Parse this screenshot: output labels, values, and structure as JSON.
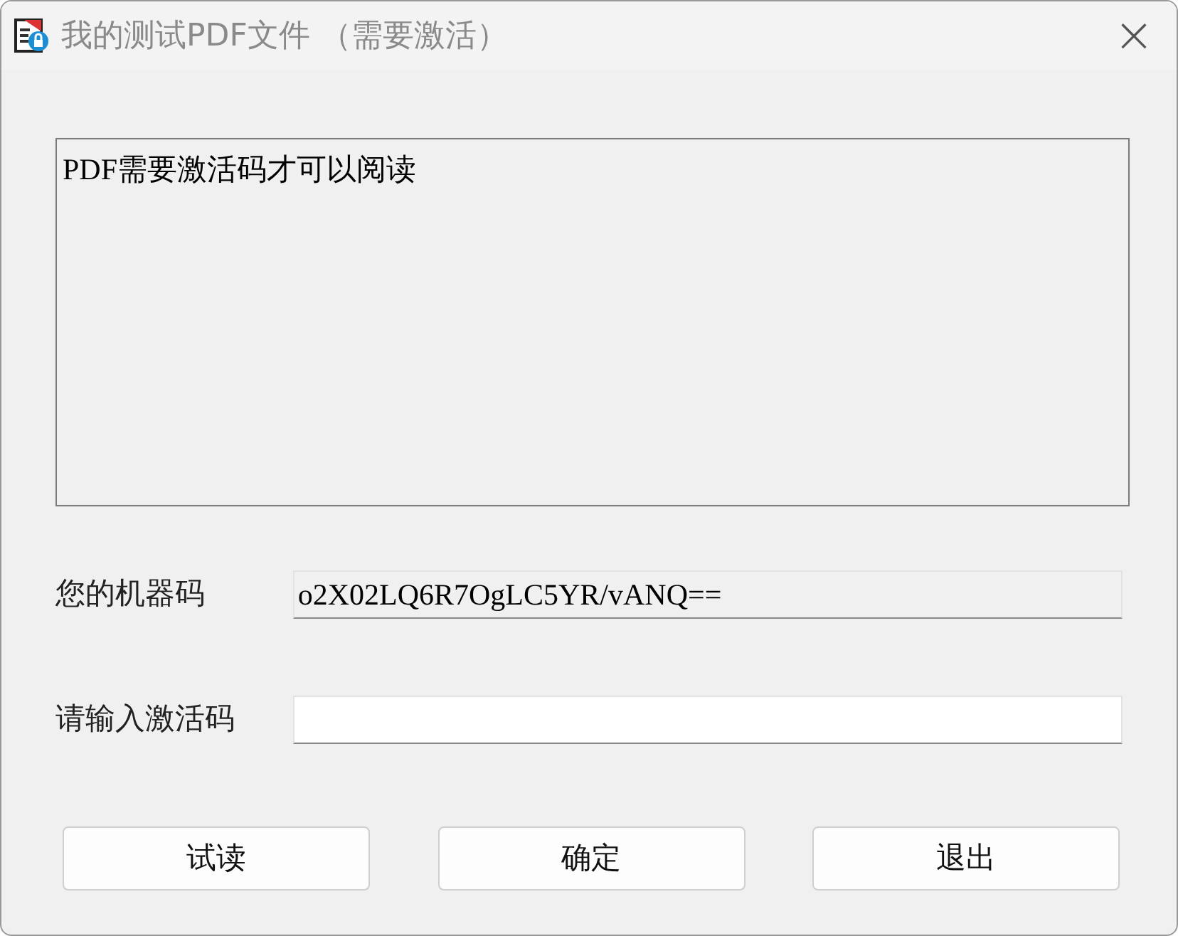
{
  "window": {
    "title": "我的测试PDF文件 （需要激活）",
    "close": "×"
  },
  "message": "PDF需要激活码才可以阅读",
  "fields": [
    {
      "label": "您的机器码",
      "value": "o2X02LQ6R7OgLC5YR/vANQ==",
      "readonly": true
    },
    {
      "label": "请输入激活码",
      "readonly": false
    }
  ],
  "buttons": [
    "试读",
    "确定",
    "退出"
  ]
}
